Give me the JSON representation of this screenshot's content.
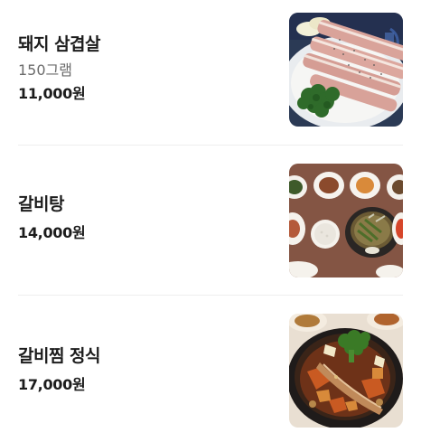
{
  "menu": {
    "items": [
      {
        "name": "돼지 삼겹살",
        "description": "150그램",
        "price": "11,000원",
        "photo": "pork-belly-plate-photo"
      },
      {
        "name": "갈비탕",
        "description": "",
        "price": "14,000원",
        "photo": "galbitang-set-photo"
      },
      {
        "name": "갈비찜 정식",
        "description": "",
        "price": "17,000원",
        "photo": "galbijjim-stone-pot-photo"
      }
    ]
  },
  "colors": {
    "text_primary": "#1c1c1c",
    "text_secondary": "#6b6b6b",
    "divider": "#eeeeee"
  }
}
